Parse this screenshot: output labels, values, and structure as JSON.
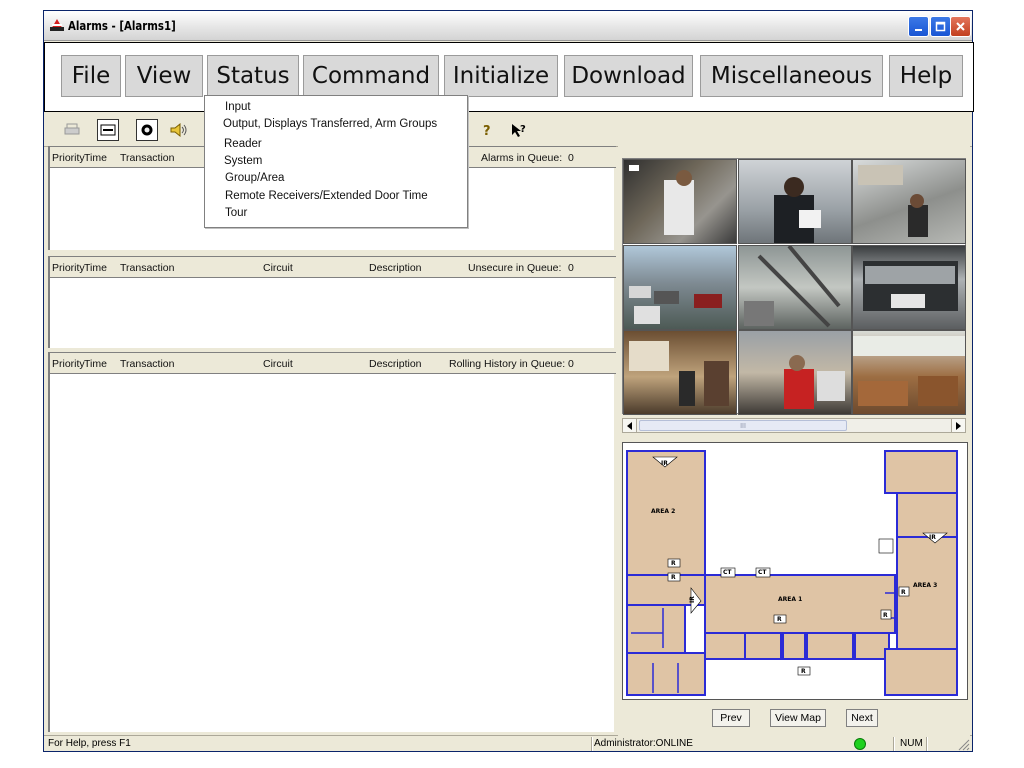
{
  "window": {
    "title": "Alarms - [Alarms1]"
  },
  "menu": {
    "items": [
      {
        "label": "File"
      },
      {
        "label": "View"
      },
      {
        "label": "Status"
      },
      {
        "label": "Command"
      },
      {
        "label": "Initialize"
      },
      {
        "label": "Download"
      },
      {
        "label": "Miscellaneous"
      },
      {
        "label": "Help"
      }
    ]
  },
  "status_menu": {
    "items": [
      {
        "label": "Input"
      },
      {
        "label": "Output, Displays Transferred, Arm Groups"
      },
      {
        "label": "Reader"
      },
      {
        "label": "System"
      },
      {
        "label": "Group/Area"
      },
      {
        "label": "Remote Receivers/Extended Door Time"
      },
      {
        "label": "Tour"
      }
    ]
  },
  "toolbar": {
    "icons": [
      "print-icon",
      "window-icon",
      "record-icon",
      "speaker-icon",
      "help-icon",
      "context-help-icon"
    ]
  },
  "alarms_pane": {
    "columns": {
      "priority": "Priority",
      "time": "Time",
      "transaction": "Transaction"
    },
    "queue_label": "Alarms in Queue:",
    "queue_count": "0"
  },
  "unsecure_pane": {
    "columns": {
      "priority": "Priority",
      "time": "Time",
      "transaction": "Transaction",
      "circuit": "Circuit",
      "description": "Description"
    },
    "queue_label": "Unsecure in Queue:",
    "queue_count": "0"
  },
  "history_pane": {
    "columns": {
      "priority": "Priority",
      "time": "Time",
      "transaction": "Transaction",
      "circuit": "Circuit",
      "description": "Description"
    },
    "queue_label": "Rolling History in Queue:",
    "queue_count": "0"
  },
  "video": {
    "scroll_grip": "III"
  },
  "map": {
    "areas": [
      "AREA 1",
      "AREA 2",
      "AREA 3"
    ],
    "markers": {
      "ir": "IR",
      "reader": "R",
      "ct": "CT"
    },
    "nav": {
      "prev": "Prev",
      "view_map": "View Map",
      "next": "Next"
    }
  },
  "statusbar": {
    "help": "For Help, press F1",
    "user": "Administrator:ONLINE",
    "num": "NUM",
    "connection_color": "#1fd11f"
  },
  "colors": {
    "floor": "#dfc4a5",
    "walls": "#2b2bd6",
    "close_button": "#c2401f",
    "app_icon": "#d21e1e"
  }
}
